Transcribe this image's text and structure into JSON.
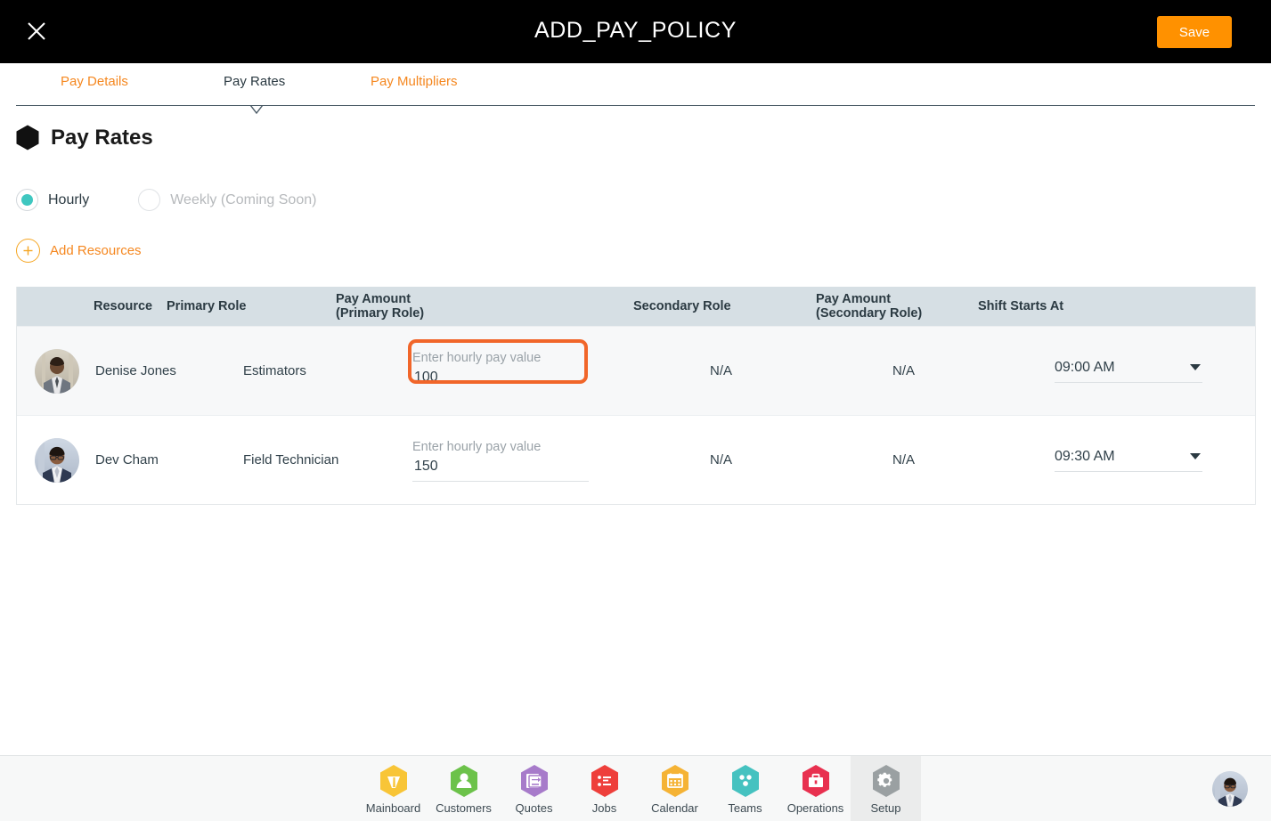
{
  "topbar": {
    "close_icon": "close-icon",
    "title": "ADD_PAY_POLICY",
    "save_label": "Save",
    "save_color": "#FF9100"
  },
  "tabs": [
    {
      "label": "Pay Details",
      "active": false
    },
    {
      "label": "Pay Rates",
      "active": true
    },
    {
      "label": "Pay Multipliers",
      "active": false
    }
  ],
  "section": {
    "icon": "hexagon-icon",
    "title": "Pay Rates"
  },
  "rate_type": {
    "selected": "Hourly",
    "options": [
      {
        "label": "Hourly",
        "selected": true,
        "disabled": false
      },
      {
        "label": "Weekly (Coming Soon)",
        "selected": false,
        "disabled": true
      }
    ],
    "accent_color": "#3FC7C0"
  },
  "add_resources": {
    "icon": "plus-circle-icon",
    "label": "Add Resources",
    "color": "#F5871F"
  },
  "table": {
    "header_bg": "#D6DFE4",
    "columns": [
      {
        "label": "Resource",
        "sub": ""
      },
      {
        "label": "Primary Role",
        "sub": ""
      },
      {
        "label": "Pay Amount",
        "sub": "(Primary Role)"
      },
      {
        "label": "Secondary Role",
        "sub": ""
      },
      {
        "label": "Pay Amount",
        "sub": "(Secondary Role)"
      },
      {
        "label": "Shift Starts At",
        "sub": ""
      }
    ],
    "rows": [
      {
        "avatar": "avatar-denise-jones",
        "resource": "Denise Jones",
        "primary_role": "Estimators",
        "pay_primary_placeholder": "Enter hourly pay value",
        "pay_primary_value": "100",
        "secondary_role": "N/A",
        "pay_secondary": "N/A",
        "shift_starts_at": "09:00 AM"
      },
      {
        "avatar": "avatar-dev-cham",
        "resource": "Dev Cham",
        "primary_role": "Field Technician",
        "pay_primary_placeholder": "Enter hourly pay value",
        "pay_primary_value": "150",
        "secondary_role": "N/A",
        "pay_secondary": "N/A",
        "shift_starts_at": "09:30 AM"
      }
    ]
  },
  "highlight": {
    "target": "pay-amount-primary-input-row-1",
    "color": "#F1662A"
  },
  "bottom_nav": {
    "items": [
      {
        "label": "Mainboard",
        "icon": "mainboard-icon",
        "color": "#F8C537",
        "active": false
      },
      {
        "label": "Customers",
        "icon": "customers-icon",
        "color": "#6CC24A",
        "active": false
      },
      {
        "label": "Quotes",
        "icon": "quotes-icon",
        "color": "#A77BCA",
        "active": false
      },
      {
        "label": "Jobs",
        "icon": "jobs-icon",
        "color": "#EE3F3B",
        "active": false
      },
      {
        "label": "Calendar",
        "icon": "calendar-icon",
        "color": "#F5B335",
        "active": false
      },
      {
        "label": "Teams",
        "icon": "teams-icon",
        "color": "#45C2C0",
        "active": false
      },
      {
        "label": "Operations",
        "icon": "operations-icon",
        "color": "#E8304F",
        "active": false
      },
      {
        "label": "Setup",
        "icon": "setup-icon",
        "color": "#9AA0A2",
        "active": true
      }
    ],
    "avatar": "user-avatar"
  }
}
